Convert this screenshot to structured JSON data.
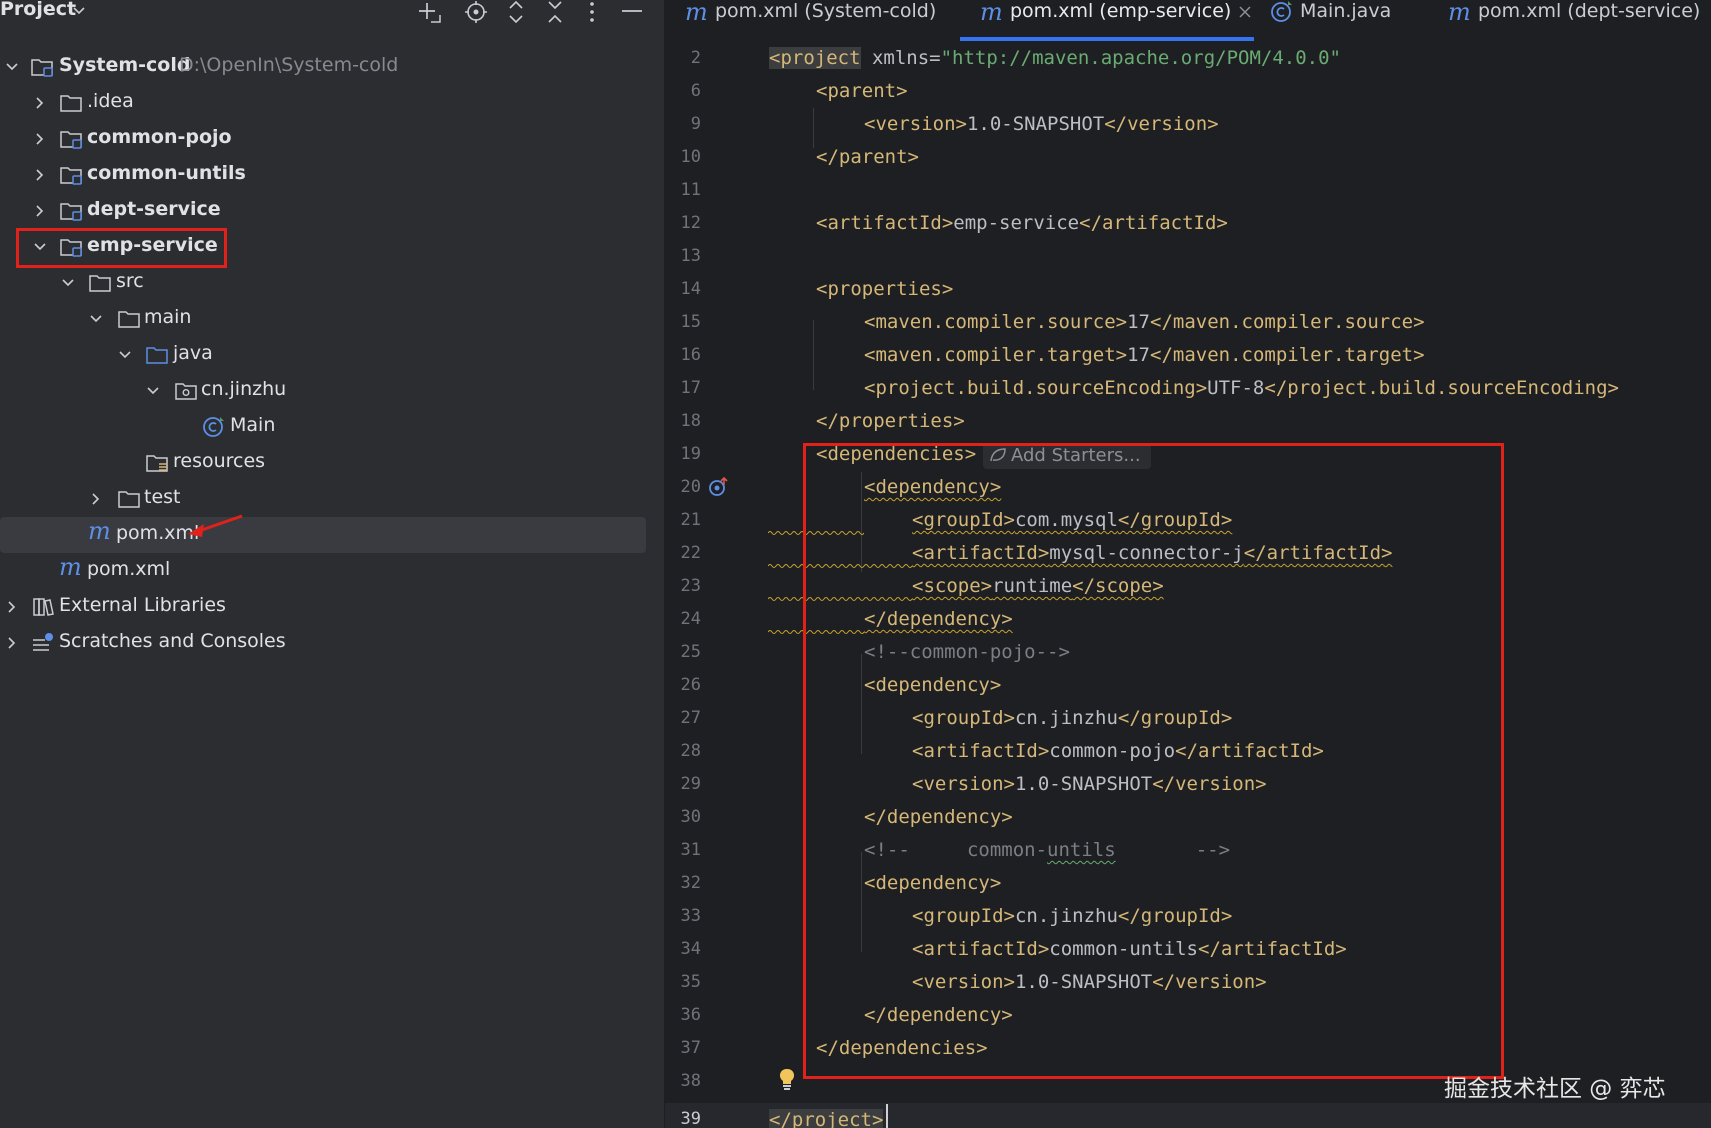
{
  "project_panel": {
    "title": "Project",
    "toolbar_icons": [
      "add-icon",
      "locate-icon",
      "expand-all-icon",
      "collapse-all-icon",
      "more-icon",
      "minimize-icon"
    ],
    "tree": {
      "root": {
        "label": "System-cold",
        "path": "D:\\OpenIn\\System-cold"
      },
      "idea": {
        "label": ".idea"
      },
      "common_pojo": {
        "label": "common-pojo"
      },
      "common_untils": {
        "label": "common-untils"
      },
      "dept_service": {
        "label": "dept-service"
      },
      "emp_service": {
        "label": "emp-service"
      },
      "src": {
        "label": "src"
      },
      "main": {
        "label": "main"
      },
      "java": {
        "label": "java"
      },
      "package": {
        "label": "cn.jinzhu"
      },
      "main_class": {
        "label": "Main"
      },
      "resources": {
        "label": "resources"
      },
      "test": {
        "label": "test"
      },
      "emp_pom": {
        "label": "pom.xml"
      },
      "root_pom": {
        "label": "pom.xml"
      },
      "external_libraries": {
        "label": "External Libraries"
      },
      "scratches": {
        "label": "Scratches and Consoles"
      }
    }
  },
  "tabs": [
    {
      "label": "pom.xml (System-cold)",
      "icon": "maven-icon",
      "active": false
    },
    {
      "label": "pom.xml (emp-service)",
      "icon": "maven-icon",
      "active": true
    },
    {
      "label": "Main.java",
      "icon": "java-class-icon",
      "active": false
    },
    {
      "label": "pom.xml (dept-service)",
      "icon": "maven-icon",
      "active": false
    }
  ],
  "editor": {
    "line_numbers": [
      "2",
      "6",
      "9",
      "10",
      "11",
      "12",
      "13",
      "14",
      "15",
      "16",
      "17",
      "18",
      "19",
      "20",
      "21",
      "22",
      "23",
      "24",
      "25",
      "26",
      "27",
      "28",
      "29",
      "30",
      "31",
      "32",
      "33",
      "34",
      "35",
      "36",
      "37",
      "38",
      "39"
    ],
    "add_starters_label": "Add Starters...",
    "code": {
      "l2_tag": "<project",
      "l2_attr": " xmlns=",
      "l2_str": "\"http://maven.apache.org/POM/4.0.0\"",
      "l6": "<parent>",
      "l9_open": "<version>",
      "l9_text": "1.0-SNAPSHOT",
      "l9_close": "</version>",
      "l10": "</parent>",
      "l12_open": "<artifactId>",
      "l12_text": "emp-service",
      "l12_close": "</artifactId>",
      "l14": "<properties>",
      "l15_open": "<maven.compiler.source>",
      "l15_text": "17",
      "l15_close": "</maven.compiler.source>",
      "l16_open": "<maven.compiler.target>",
      "l16_text": "17",
      "l16_close": "</maven.compiler.target>",
      "l17_open": "<project.build.sourceEncoding>",
      "l17_text": "UTF-8",
      "l17_close": "</project.build.sourceEncoding>",
      "l18": "</properties>",
      "l19": "<dependencies>",
      "l20": "<dependency>",
      "l21_open": "<groupId>",
      "l21_text": "com.mysql",
      "l21_close": "</groupId>",
      "l22_open": "<artifactId>",
      "l22_text": "mysql-connector-j",
      "l22_close": "</artifactId>",
      "l23_open": "<scope>",
      "l23_text": "runtime",
      "l23_close": "</scope>",
      "l24": "</dependency>",
      "l25": "<!--common-pojo-->",
      "l26": "<dependency>",
      "l27_open": "<groupId>",
      "l27_text": "cn.jinzhu",
      "l27_close": "</groupId>",
      "l28_open": "<artifactId>",
      "l28_text": "common-pojo",
      "l28_close": "</artifactId>",
      "l29_open": "<version>",
      "l29_text": "1.0-SNAPSHOT",
      "l29_close": "</version>",
      "l30": "</dependency>",
      "l31_a": "<!--     common-",
      "l31_b": "untils",
      "l31_c": "       -->",
      "l32": "<dependency>",
      "l33_open": "<groupId>",
      "l33_text": "cn.jinzhu",
      "l33_close": "</groupId>",
      "l34_open": "<artifactId>",
      "l34_text": "common-untils",
      "l34_close": "</artifactId>",
      "l35_open": "<version>",
      "l35_text": "1.0-SNAPSHOT",
      "l35_close": "</version>",
      "l36": "</dependency>",
      "l37": "</dependencies>",
      "l39": "</project>"
    }
  },
  "watermark": "掘金技术社区 @ 弈芯",
  "colors": {
    "annotation_red": "#e0221b",
    "accent_blue": "#3574f0",
    "xml_tag": "#d5b778",
    "xml_string": "#6aab73"
  }
}
